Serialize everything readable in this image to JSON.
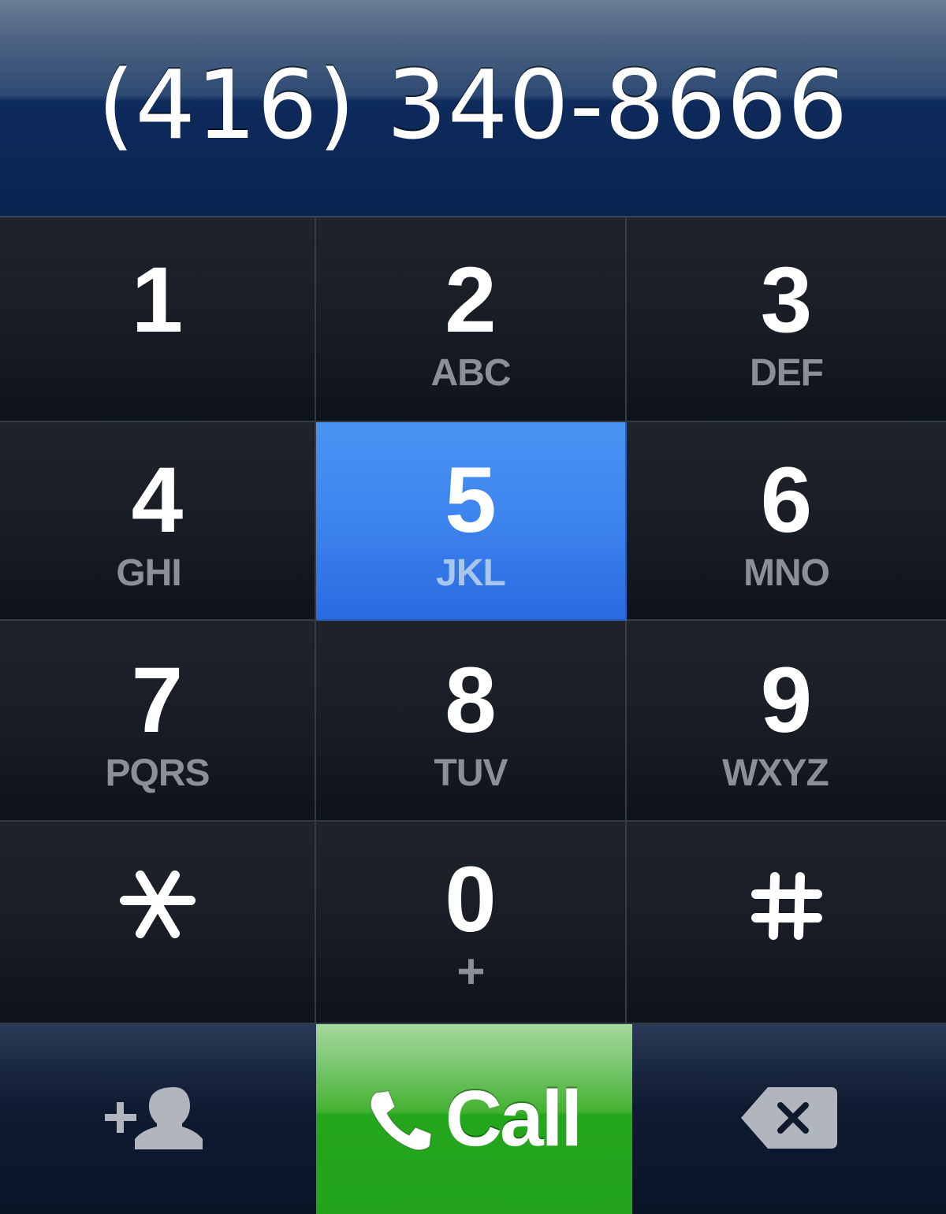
{
  "display": {
    "number": "(416) 340-8666"
  },
  "keypad": {
    "keys": [
      {
        "digit": "1",
        "letters": ""
      },
      {
        "digit": "2",
        "letters": "ABC"
      },
      {
        "digit": "3",
        "letters": "DEF"
      },
      {
        "digit": "4",
        "letters": "GHI"
      },
      {
        "digit": "5",
        "letters": "JKL"
      },
      {
        "digit": "6",
        "letters": "MNO"
      },
      {
        "digit": "7",
        "letters": "PQRS"
      },
      {
        "digit": "8",
        "letters": "TUV"
      },
      {
        "digit": "9",
        "letters": "WXYZ"
      },
      {
        "digit": "*",
        "letters": "",
        "icon": "asterisk-icon"
      },
      {
        "digit": "0",
        "letters": "+"
      },
      {
        "digit": "#",
        "letters": "",
        "icon": "hash-icon"
      }
    ],
    "pressed_key": "5"
  },
  "actions": {
    "add_contact_icon": "add-contact-icon",
    "call_label": "Call",
    "call_icon": "phone-handset-icon",
    "backspace_icon": "backspace-icon"
  },
  "colors": {
    "pressed_key": "#3d84ee",
    "call_button": "#22a31b",
    "letters": "#8b9098"
  }
}
